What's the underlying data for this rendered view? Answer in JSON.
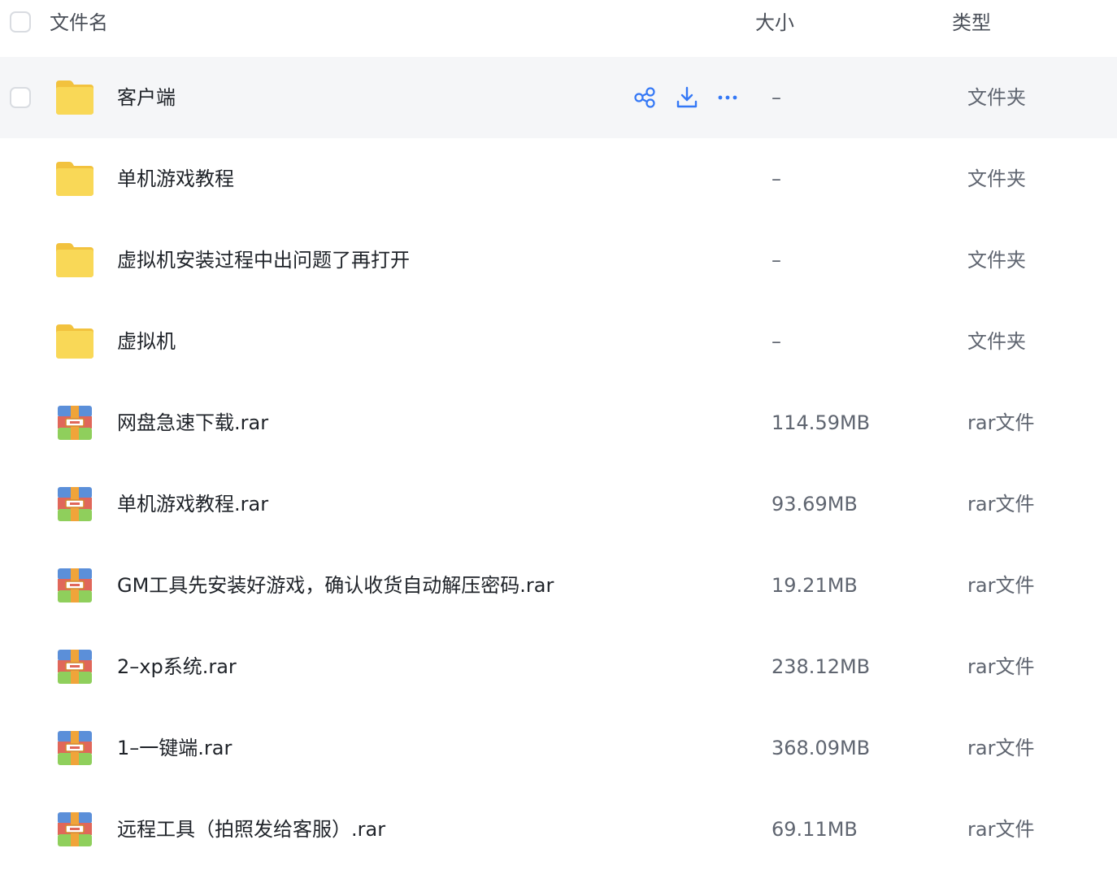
{
  "header": {
    "name_label": "文件名",
    "size_label": "大小",
    "type_label": "类型"
  },
  "colors": {
    "accent": "#3478f6",
    "folder": "#f7cf4a",
    "hover_row": "#f5f6f8"
  },
  "row_actions": {
    "share_icon": "share-icon",
    "download_icon": "download-icon",
    "more_icon": "more-icon"
  },
  "files": [
    {
      "name": "客户端",
      "size": "–",
      "type": "文件夹",
      "icon": "folder-icon"
    },
    {
      "name": "单机游戏教程",
      "size": "–",
      "type": "文件夹",
      "icon": "folder-icon"
    },
    {
      "name": "虚拟机安装过程中出问题了再打开",
      "size": "–",
      "type": "文件夹",
      "icon": "folder-icon"
    },
    {
      "name": "虚拟机",
      "size": "–",
      "type": "文件夹",
      "icon": "folder-icon"
    },
    {
      "name": "网盘急速下载.rar",
      "size": "114.59MB",
      "type": "rar文件",
      "icon": "rar-icon"
    },
    {
      "name": "单机游戏教程.rar",
      "size": "93.69MB",
      "type": "rar文件",
      "icon": "rar-icon"
    },
    {
      "name": "GM工具先安装好游戏，确认收货自动解压密码.rar",
      "size": "19.21MB",
      "type": "rar文件",
      "icon": "rar-icon"
    },
    {
      "name": "2–xp系统.rar",
      "size": "238.12MB",
      "type": "rar文件",
      "icon": "rar-icon"
    },
    {
      "name": "1–一键端.rar",
      "size": "368.09MB",
      "type": "rar文件",
      "icon": "rar-icon"
    },
    {
      "name": "远程工具（拍照发给客服）.rar",
      "size": "69.11MB",
      "type": "rar文件",
      "icon": "rar-icon"
    }
  ]
}
